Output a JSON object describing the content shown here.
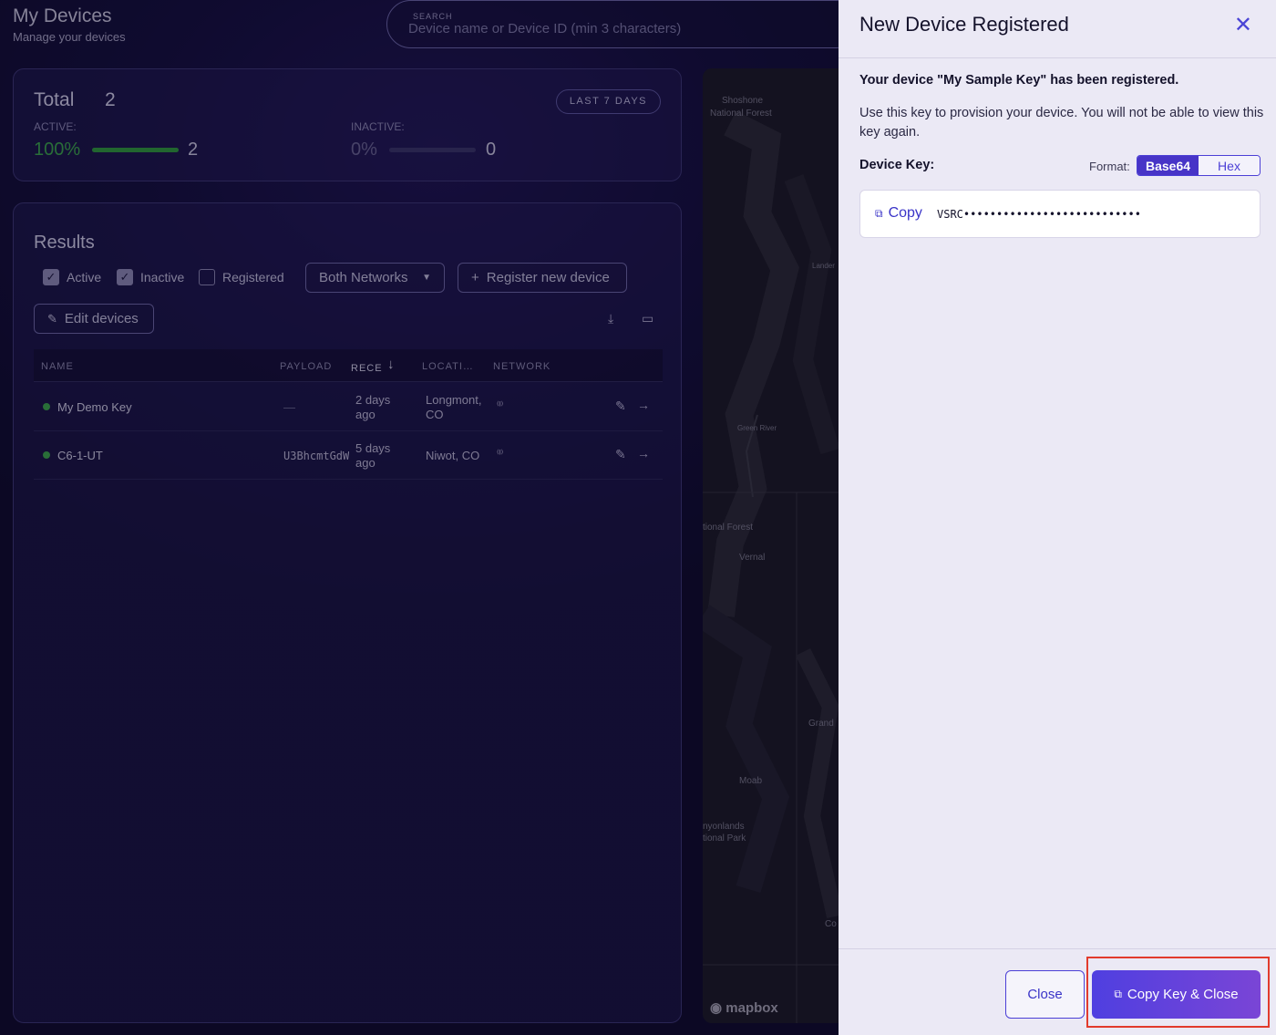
{
  "header": {
    "title": "My Devices",
    "subtitle": "Manage your devices"
  },
  "search": {
    "label": "SEARCH",
    "placeholder": "Device name or Device ID (min 3 characters)"
  },
  "summary": {
    "total_label": "Total",
    "total_value": "2",
    "range_button": "LAST 7 DAYS",
    "active": {
      "label": "ACTIVE:",
      "percent": "100%",
      "count": "2",
      "fill": 1.0,
      "color": "#2e9a3d"
    },
    "inactive": {
      "label": "INACTIVE:",
      "percent": "0%",
      "count": "0",
      "fill": 0.0,
      "color": "#5a5590"
    }
  },
  "results": {
    "title": "Results",
    "filters": [
      {
        "label": "Active",
        "checked": true
      },
      {
        "label": "Inactive",
        "checked": true
      },
      {
        "label": "Registered",
        "checked": false
      }
    ],
    "network_select": "Both Networks",
    "register_button": "Register new device",
    "edit_button": "Edit devices",
    "columns": [
      "NAME",
      "PAYLOAD",
      "RECE",
      "LOCATI…",
      "NETWORK"
    ],
    "rows": [
      {
        "name": "My Demo Key",
        "payload": "—",
        "received_1": "2 days",
        "received_2": "ago",
        "location_1": "Longmont,",
        "location_2": "CO",
        "network_icon": "antenna-icon"
      },
      {
        "name": "C6-1-UT",
        "payload": "U3BhcmtGdW",
        "received_1": "5 days",
        "received_2": "ago",
        "location_1": "Niwot, CO",
        "location_2": "",
        "network_icon": "antenna-icon"
      }
    ]
  },
  "map": {
    "labels": [
      "Shoshone",
      "National Forest",
      "Lander",
      "Green River",
      "tional Forest",
      "Vernal",
      "Grand",
      "Moab",
      "nyonlands",
      "tional Park",
      "Co"
    ],
    "attribution": "mapbox"
  },
  "drawer": {
    "title": "New Device Registered",
    "registered_message": "Your device \"My Sample Key\" has been registered.",
    "provision_message": "Use this key to provision your device. You will not be able to view this key again.",
    "device_key_label": "Device Key:",
    "format_label": "Format:",
    "format_options": [
      "Base64",
      "Hex"
    ],
    "format_selected": "Base64",
    "copy_label": "Copy",
    "key_value": "VSRC•••••••••••••••••••••••••••",
    "close_button": "Close",
    "copy_close_button": "Copy Key & Close",
    "accent": "#4734c7"
  }
}
